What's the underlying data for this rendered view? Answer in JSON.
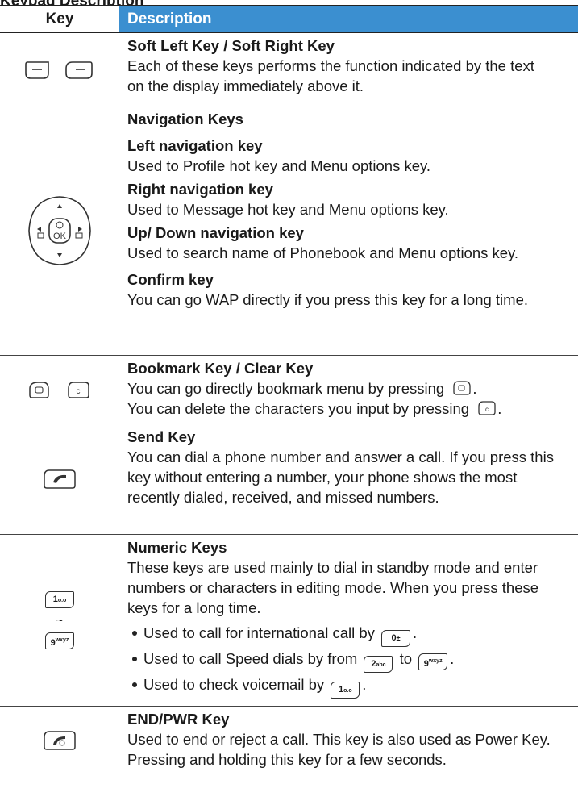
{
  "page_heading_fragment": "Keypad Description",
  "table": {
    "col_key": "Key",
    "col_desc": "Description"
  },
  "rows": {
    "soft": {
      "title": "Soft Left Key / Soft Right Key",
      "text": "Each of these keys performs the function indicated by the text on the display immediately above it."
    },
    "nav": {
      "title": "Navigation Keys",
      "left_title": "Left navigation key",
      "left_text": "Used to Profile hot key and Menu options key.",
      "right_title": "Right navigation key",
      "right_text": "Used to Message hot key and Menu options key.",
      "updown_title": "Up/ Down navigation key",
      "updown_text": "Used to search name of Phonebook and Menu options key.",
      "confirm_title": "Confirm key",
      "confirm_text": "You can go WAP directly if you press this key for a long time.",
      "ok_label": "OK"
    },
    "bookmark": {
      "title": "Bookmark Key / Clear Key",
      "line1": "You can go directly bookmark menu by pressing",
      "line2": "You can delete the characters you input by pressing",
      "clear_label": "c"
    },
    "send": {
      "title": "Send Key",
      "text": "You can dial a phone number and answer a call. If you press this key without entering a number, your phone shows the most recently dialed, received, and missed numbers."
    },
    "numeric": {
      "title": "Numeric Keys",
      "text": "These keys are used mainly to dial in standby mode and enter numbers or characters in editing mode. When you press these keys for a long time.",
      "key1_label": "1",
      "key9_label": "9",
      "tilde": "~",
      "bullet1": "Used to call for international call by",
      "bullet2_a": "Used to call Speed dials by from",
      "bullet2_b": "to",
      "bullet3": "Used to check voicemail by",
      "key0_label": "0",
      "key2_label": "2",
      "key2_sub": "abc",
      "key9_sub": "wxyz",
      "key1_sub": "o.o",
      "period": "."
    },
    "end": {
      "title": "END/PWR Key",
      "text": "Used to end or reject a call. This key is also used as Power Key. Pressing and holding this key for a few seconds."
    }
  }
}
